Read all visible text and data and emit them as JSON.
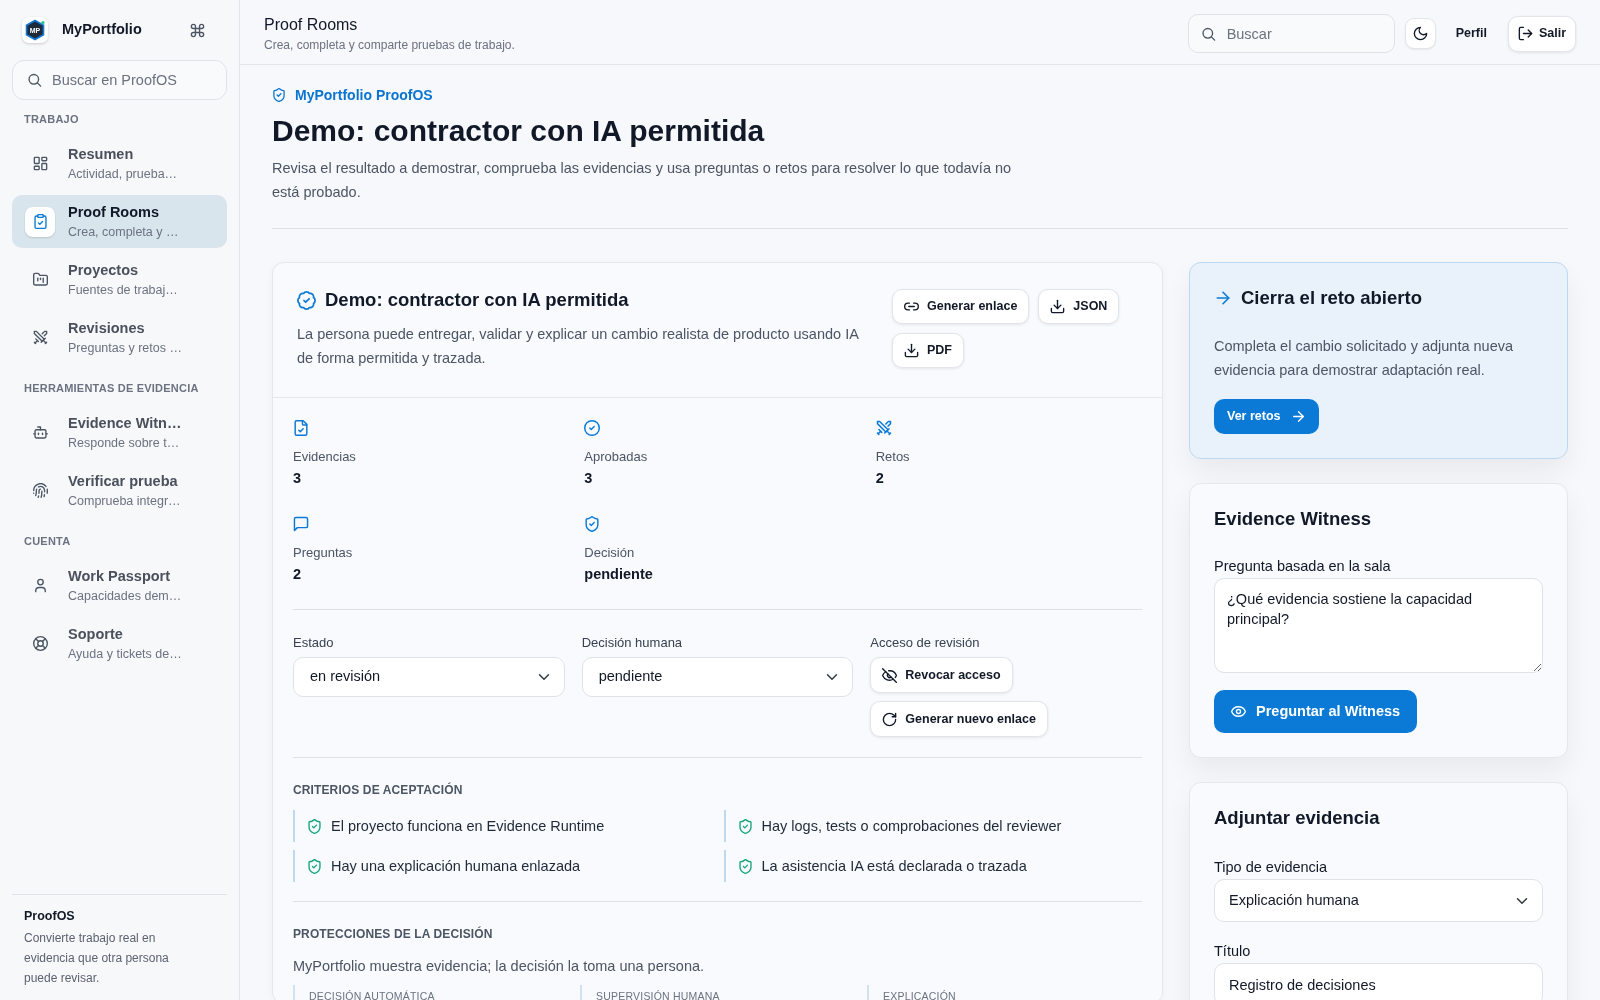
{
  "sidebar": {
    "logo_text": "MP",
    "brand": "MyPortfolio",
    "search": {
      "placeholder": "Buscar en ProofOS"
    },
    "sections": [
      {
        "heading": "TRABAJO",
        "items": [
          {
            "title": "Resumen",
            "subtitle": "Actividad, prueba…",
            "selected": false
          },
          {
            "title": "Proof Rooms",
            "subtitle": "Crea, completa y …",
            "selected": true
          },
          {
            "title": "Proyectos",
            "subtitle": "Fuentes de trabaj…",
            "selected": false
          },
          {
            "title": "Revisiones",
            "subtitle": "Preguntas y retos …",
            "selected": false
          }
        ]
      },
      {
        "heading": "HERRAMIENTAS DE EVIDENCIA",
        "items": [
          {
            "title": "Evidence Witn…",
            "subtitle": "Responde sobre t…",
            "selected": false
          },
          {
            "title": "Verificar prueba",
            "subtitle": "Comprueba integr…",
            "selected": false
          }
        ]
      },
      {
        "heading": "CUENTA",
        "items": [
          {
            "title": "Work Passport",
            "subtitle": "Capacidades dem…",
            "selected": false
          },
          {
            "title": "Soporte",
            "subtitle": "Ayuda y tickets de…",
            "selected": false
          }
        ]
      }
    ],
    "footer": {
      "title": "ProofOS",
      "text": "Convierte trabajo real en evidencia que otra persona puede revisar."
    }
  },
  "header": {
    "title": "Proof Rooms",
    "subtitle": "Crea, completa y comparte pruebas de trabajo.",
    "search": {
      "placeholder": "Buscar"
    },
    "profile_link": "Perfil",
    "logout_button": "Salir"
  },
  "page": {
    "breadcrumb": "MyPortfolio ProofOS",
    "title": "Demo: contractor con IA permitida",
    "description": "Revisa el resultado a demostrar, comprueba las evidencias y usa preguntas o retos para resolver lo que todavía no está probado."
  },
  "room_card": {
    "title": "Demo: contractor con IA permitida",
    "description": "La persona puede entregar, validar y explicar un cambio realista de producto usando IA de forma permitida y trazada.",
    "actions": [
      "Generar enlace",
      "JSON",
      "PDF"
    ],
    "stats": [
      {
        "label": "Evidencias",
        "value": "3"
      },
      {
        "label": "Aprobadas",
        "value": "3"
      },
      {
        "label": "Retos",
        "value": "2"
      },
      {
        "label": "Preguntas",
        "value": "2"
      },
      {
        "label": "Decisión",
        "value": "pendiente"
      }
    ],
    "fields": [
      {
        "label": "Estado",
        "value": "en revisión"
      },
      {
        "label": "Decisión humana",
        "value": "pendiente"
      }
    ],
    "access": {
      "label": "Acceso de revisión",
      "buttons": [
        "Revocar acceso",
        "Generar nuevo enlace"
      ]
    },
    "criteria": {
      "heading": "CRITERIOS DE ACEPTACIÓN",
      "items": [
        "El proyecto funciona en Evidence Runtime",
        "Hay logs, tests o comprobaciones del reviewer",
        "Hay una explicación humana enlazada",
        "La asistencia IA está declarada o trazada"
      ]
    },
    "safeguards": {
      "heading": "PROTECCIONES DE LA DECISIÓN",
      "text": "MyPortfolio muestra evidencia; la decisión la toma una persona.",
      "columns": [
        "DECISIÓN AUTOMÁTICA",
        "SUPERVISIÓN HUMANA",
        "EXPLICACIÓN"
      ]
    }
  },
  "challenge_card": {
    "title": "Cierra el reto abierto",
    "text": "Completa el cambio solicitado y adjunta nueva evidencia para demostrar adaptación real.",
    "button": "Ver retos"
  },
  "witness_card": {
    "title": "Evidence Witness",
    "field_label": "Pregunta basada en la sala",
    "question": "¿Qué evidencia sostiene la capacidad principal?",
    "button": "Preguntar al Witness"
  },
  "attach_card": {
    "title": "Adjuntar evidencia",
    "fields": [
      {
        "kind": "select",
        "label": "Tipo de evidencia",
        "value": "Explicación humana"
      },
      {
        "kind": "text",
        "label": "Título",
        "value": "Registro de decisiones"
      }
    ]
  }
}
